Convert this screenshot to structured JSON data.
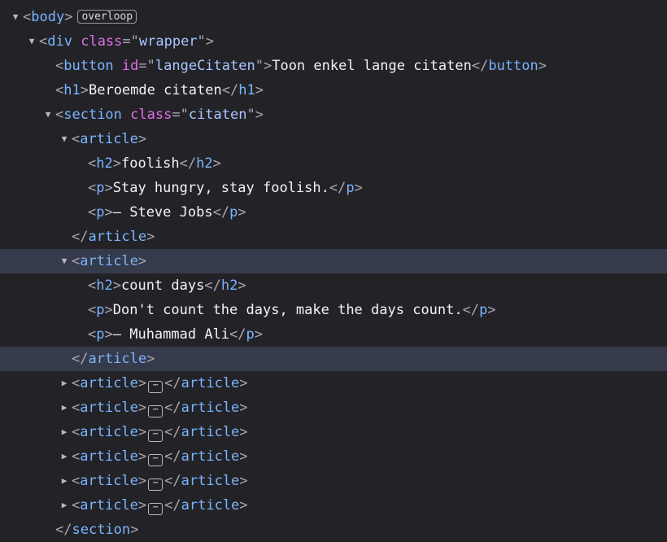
{
  "colors": {
    "background": "#232327",
    "highlight_row": "#363b4b",
    "tag": "#7ab4ff",
    "attribute": "#e36ee8",
    "attribute_value": "#a8c6ff",
    "punctuation": "#a7a7b3",
    "text": "#f2f2f7"
  },
  "icons": {
    "expanded": "triangle-down-icon",
    "collapsed": "triangle-right-icon",
    "collapsed_content": "ellipsis-icon"
  },
  "nodes": [
    {
      "indent": 0,
      "toggle": "open",
      "kind": "open",
      "tag": "body",
      "badge": "overloop"
    },
    {
      "indent": 1,
      "toggle": "open",
      "kind": "open",
      "tag": "div",
      "attr": "class",
      "val": "wrapper"
    },
    {
      "indent": 2,
      "toggle": "none",
      "kind": "inline",
      "tag": "button",
      "attr": "id",
      "val": "langeCitaten",
      "text": "Toon enkel lange citaten"
    },
    {
      "indent": 2,
      "toggle": "none",
      "kind": "inline",
      "tag": "h1",
      "text": "Beroemde citaten"
    },
    {
      "indent": 2,
      "toggle": "open",
      "kind": "open",
      "tag": "section",
      "attr": "class",
      "val": "citaten"
    },
    {
      "indent": 3,
      "toggle": "open",
      "kind": "open",
      "tag": "article"
    },
    {
      "indent": 4,
      "toggle": "none",
      "kind": "inline",
      "tag": "h2",
      "text": "foolish"
    },
    {
      "indent": 4,
      "toggle": "none",
      "kind": "inline",
      "tag": "p",
      "text": "Stay hungry, stay foolish."
    },
    {
      "indent": 4,
      "toggle": "none",
      "kind": "inline",
      "tag": "p",
      "text": "— Steve Jobs"
    },
    {
      "indent": 3,
      "toggle": "none",
      "kind": "close",
      "tag": "article"
    },
    {
      "indent": 3,
      "toggle": "open",
      "kind": "open",
      "tag": "article",
      "highlight": true
    },
    {
      "indent": 4,
      "toggle": "none",
      "kind": "inline",
      "tag": "h2",
      "text": "count days"
    },
    {
      "indent": 4,
      "toggle": "none",
      "kind": "inline",
      "tag": "p",
      "text": "Don't count the days, make the days count."
    },
    {
      "indent": 4,
      "toggle": "none",
      "kind": "inline",
      "tag": "p",
      "text": "— Muhammad Ali"
    },
    {
      "indent": 3,
      "toggle": "none",
      "kind": "close",
      "tag": "article",
      "highlight": true
    },
    {
      "indent": 3,
      "toggle": "closed",
      "kind": "collapsed",
      "tag": "article"
    },
    {
      "indent": 3,
      "toggle": "closed",
      "kind": "collapsed",
      "tag": "article"
    },
    {
      "indent": 3,
      "toggle": "closed",
      "kind": "collapsed",
      "tag": "article"
    },
    {
      "indent": 3,
      "toggle": "closed",
      "kind": "collapsed",
      "tag": "article"
    },
    {
      "indent": 3,
      "toggle": "closed",
      "kind": "collapsed",
      "tag": "article"
    },
    {
      "indent": 3,
      "toggle": "closed",
      "kind": "collapsed",
      "tag": "article"
    },
    {
      "indent": 2,
      "toggle": "none",
      "kind": "close",
      "tag": "section"
    }
  ]
}
